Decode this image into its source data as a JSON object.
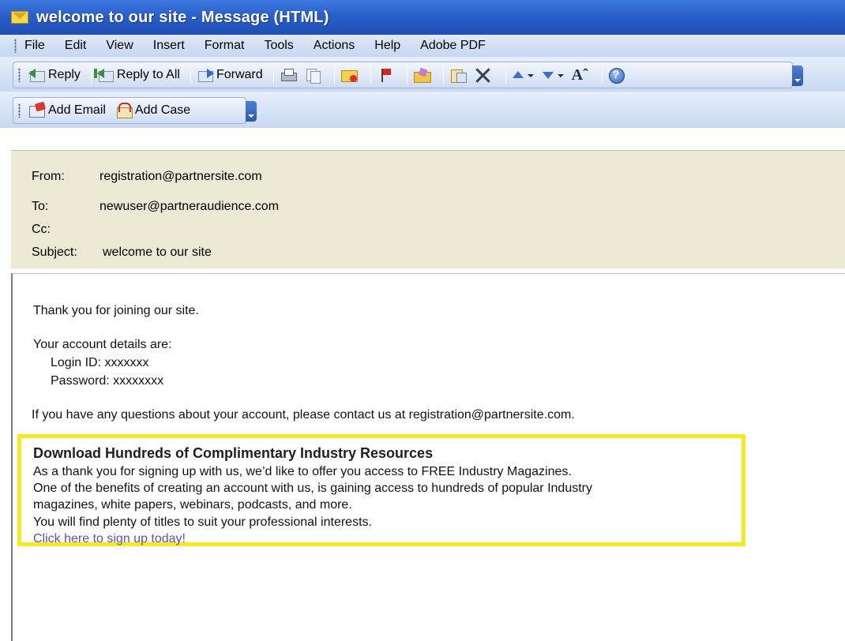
{
  "window": {
    "title": "welcome to our site - Message (HTML)"
  },
  "menu": [
    {
      "label": "File"
    },
    {
      "label": "Edit"
    },
    {
      "label": "View"
    },
    {
      "label": "Insert"
    },
    {
      "label": "Format"
    },
    {
      "label": "Tools"
    },
    {
      "label": "Actions"
    },
    {
      "label": "Help"
    },
    {
      "label": "Adobe PDF"
    }
  ],
  "toolbar": {
    "reply": "Reply",
    "reply_all": "Reply to All",
    "forward": "Forward",
    "icons": [
      "reply-icon",
      "reply-all-icon",
      "forward-icon",
      "print-icon",
      "copy-icon",
      "mark-unread-icon",
      "flag-icon",
      "folder-icon",
      "move-to-folder-icon",
      "delete-icon",
      "previous-item-icon",
      "next-item-icon",
      "font-size-icon",
      "help-icon"
    ]
  },
  "toolbar2": {
    "add_email": "Add Email",
    "add_case": "Add Case"
  },
  "header": {
    "from_label": "From:",
    "from_value": "registration@partnersite.com",
    "to_label": "To:",
    "to_value": "newuser@partneraudience.com",
    "cc_label": "Cc:",
    "cc_value": "",
    "subject_label": "Subject:",
    "subject_value": "welcome to our site"
  },
  "body": {
    "thanks": "Thank you for joining our site.",
    "account_intro": "Your account details are:",
    "login": "Login ID: xxxxxxx",
    "password": "Password: xxxxxxxx",
    "contact": "If you have any questions about your account, please contact us at registration@partnersite.com."
  },
  "promo": {
    "title": "Download Hundreds of Complimentary Industry Resources",
    "line1": "As a thank you for signing up with us, we’d like to offer you access to FREE Industry Magazines.",
    "line2": "One of the benefits of creating an account with us, is gaining access to hundreds of popular Industry",
    "line3": "magazines, white papers, webinars, podcasts, and more.",
    "line4": "You will find plenty of titles to suit  your professional interests.",
    "link": "Click here to sign up today!"
  },
  "colors": {
    "titlebar": "#2a5ec9",
    "header_bg": "#ebe8d4",
    "highlight_border": "#f4ea1f",
    "link": "#5b4fc6"
  }
}
